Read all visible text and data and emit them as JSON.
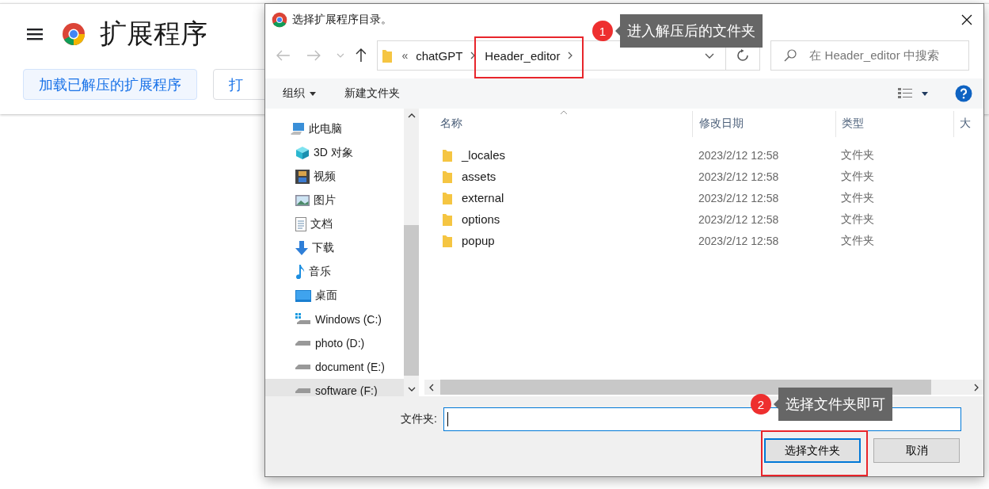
{
  "page": {
    "title": "扩展程序",
    "buttons": [
      "加载已解压的扩展程序",
      "打"
    ]
  },
  "dialog": {
    "title": "选择扩展程序目录。",
    "breadcrumb": {
      "overflow": "«",
      "segments": [
        "chatGPT",
        "Header_editor"
      ]
    },
    "search": {
      "placeholder": "在 Header_editor 中搜索"
    },
    "toolbar": {
      "organize": "组织",
      "new_folder": "新建文件夹"
    },
    "nav_items": [
      {
        "label": "此电脑",
        "kind": "pc",
        "selected": false,
        "children": [
          {
            "label": "3D 对象",
            "kind": "cube",
            "selected": false
          },
          {
            "label": "视频",
            "kind": "video",
            "selected": false
          },
          {
            "label": "图片",
            "kind": "image",
            "selected": false
          },
          {
            "label": "文档",
            "kind": "doc",
            "selected": false
          },
          {
            "label": "下载",
            "kind": "download",
            "selected": false
          },
          {
            "label": "音乐",
            "kind": "music",
            "selected": false
          },
          {
            "label": "桌面",
            "kind": "desktop",
            "selected": false
          },
          {
            "label": "Windows (C:)",
            "kind": "windows-drive",
            "selected": false
          },
          {
            "label": "photo (D:)",
            "kind": "drive",
            "selected": false
          },
          {
            "label": "document (E:)",
            "kind": "drive",
            "selected": false
          },
          {
            "label": "software (F:)",
            "kind": "drive",
            "selected": true
          }
        ]
      }
    ],
    "columns": [
      "名称",
      "修改日期",
      "类型",
      "大"
    ],
    "rows": [
      {
        "name": "_locales",
        "date": "2023/2/12 12:58",
        "type": "文件夹"
      },
      {
        "name": "assets",
        "date": "2023/2/12 12:58",
        "type": "文件夹"
      },
      {
        "name": "external",
        "date": "2023/2/12 12:58",
        "type": "文件夹"
      },
      {
        "name": "options",
        "date": "2023/2/12 12:58",
        "type": "文件夹"
      },
      {
        "name": "popup",
        "date": "2023/2/12 12:58",
        "type": "文件夹"
      }
    ],
    "folder_label": "文件夹:",
    "buttons": [
      {
        "label": "选择文件夹",
        "default": true
      },
      {
        "label": "取消",
        "default": false
      }
    ]
  },
  "annotations": [
    {
      "number": "1",
      "text": "进入解压后的文件夹"
    },
    {
      "number": "2",
      "text": "选择文件夹即可"
    }
  ]
}
